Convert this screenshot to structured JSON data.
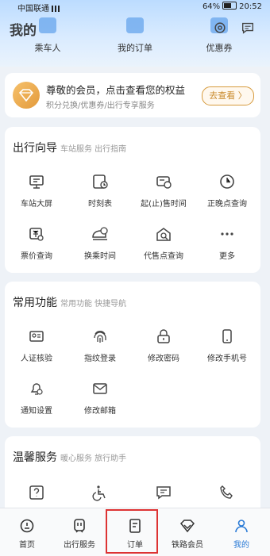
{
  "status": {
    "carrier": "中国联通",
    "battery": "64%",
    "time": "20:52"
  },
  "header": {
    "title": "我的",
    "tabs": [
      {
        "label": "乘车人",
        "icon": "passenger-icon"
      },
      {
        "label": "我的订单",
        "icon": "order-icon"
      },
      {
        "label": "优惠券",
        "icon": "coupon-icon"
      }
    ]
  },
  "member": {
    "title": "尊敬的会员，点击查看您的权益",
    "subtitle": "积分兑换/优惠券/出行专享服务",
    "button": "去查看 〉"
  },
  "travel": {
    "title": "出行向导",
    "subtitle": "车站服务 出行指南",
    "items": [
      {
        "label": "车站大屏",
        "icon": "station-screen-icon"
      },
      {
        "label": "时刻表",
        "icon": "timetable-icon"
      },
      {
        "label": "起(止)售时间",
        "icon": "sale-time-icon"
      },
      {
        "label": "正晚点查询",
        "icon": "clock-icon"
      },
      {
        "label": "票价查询",
        "icon": "fare-icon"
      },
      {
        "label": "换乘时间",
        "icon": "transfer-icon"
      },
      {
        "label": "代售点查询",
        "icon": "agency-icon"
      },
      {
        "label": "更多",
        "icon": "more-icon"
      }
    ]
  },
  "common": {
    "title": "常用功能",
    "subtitle": "常用功能 快捷导航",
    "items": [
      {
        "label": "人证核验",
        "icon": "id-card-icon"
      },
      {
        "label": "指纹登录",
        "icon": "fingerprint-icon"
      },
      {
        "label": "修改密码",
        "icon": "lock-icon"
      },
      {
        "label": "修改手机号",
        "icon": "phone-icon"
      },
      {
        "label": "通知设置",
        "icon": "bell-icon"
      },
      {
        "label": "修改邮箱",
        "icon": "mail-icon"
      }
    ]
  },
  "warm": {
    "title": "温馨服务",
    "subtitle": "暖心服务 旅行助手",
    "items": [
      {
        "label": "",
        "icon": "question-icon"
      },
      {
        "label": "",
        "icon": "wheelchair-icon"
      },
      {
        "label": "",
        "icon": "message-icon"
      },
      {
        "label": "",
        "icon": "phone-call-icon"
      }
    ]
  },
  "tabbar": [
    {
      "label": "首页",
      "icon": "home-icon"
    },
    {
      "label": "出行服务",
      "icon": "train-icon"
    },
    {
      "label": "订单",
      "icon": "order-icon"
    },
    {
      "label": "铁路会员",
      "icon": "diamond-icon"
    },
    {
      "label": "我的",
      "icon": "user-icon"
    }
  ],
  "colors": {
    "accent": "#2b7bd6",
    "gold": "#e39a3b",
    "highlight": "#dd3333"
  }
}
